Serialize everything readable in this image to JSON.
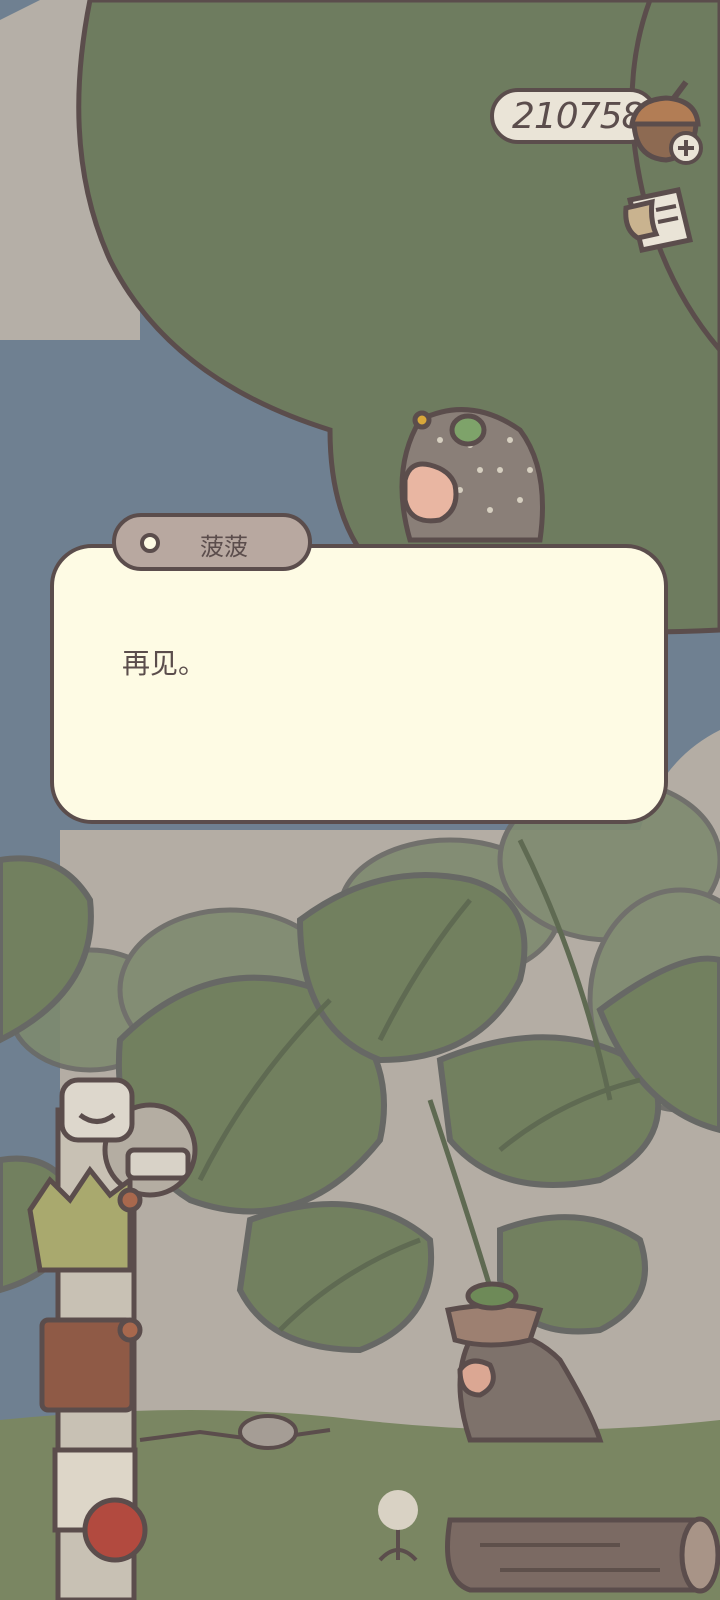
{
  "hud": {
    "currency_amount": "210758",
    "currency_icon": "acorn-icon",
    "add_icon": "plus-icon",
    "journal_icon": "notebook-icon"
  },
  "dialog": {
    "speaker": "菠菠",
    "text": "再见。"
  },
  "colors": {
    "outline": "#5b4d4c",
    "dialog_bg": "#fefbe4",
    "nametag_bg": "#b8a8a0",
    "canopy": "#6e7c5f",
    "sky": "#6f8091"
  }
}
